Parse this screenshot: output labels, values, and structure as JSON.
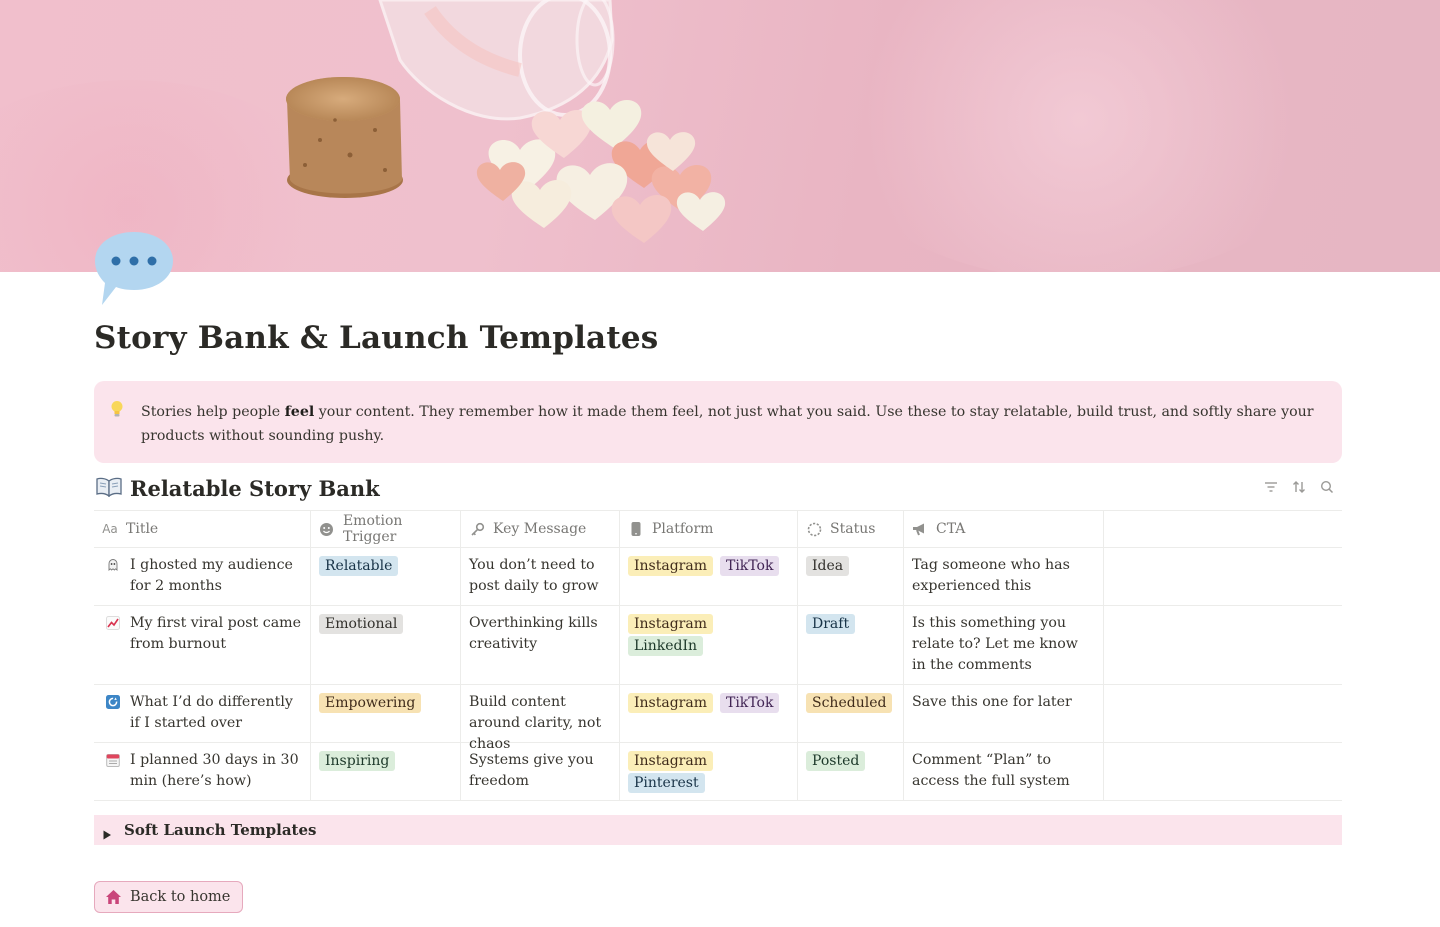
{
  "page": {
    "title": "Story Bank & Launch Templates",
    "icon": "speech-bubble-icon"
  },
  "callout": {
    "icon": "lightbulb-icon",
    "text_before": "Stories help people ",
    "text_bold": "feel",
    "text_after": " your content. They remember how it made them feel, not just what you said. Use these to stay relatable, build trust, and softly share your products without sounding pushy."
  },
  "database": {
    "icon": "open-book-icon",
    "title": "Relatable Story Bank",
    "tools": [
      "filter-icon",
      "sort-icon",
      "search-icon"
    ],
    "columns": [
      {
        "label": "Title",
        "icon": "text-aa-icon"
      },
      {
        "label": "Emotion Trigger",
        "icon": "smiley-icon"
      },
      {
        "label": "Key Message",
        "icon": "key-icon"
      },
      {
        "label": "Platform",
        "icon": "phone-icon"
      },
      {
        "label": "Status",
        "icon": "status-circle-icon"
      },
      {
        "label": "CTA",
        "icon": "megaphone-icon"
      }
    ],
    "rows": [
      {
        "icon": "ghost-icon",
        "title": "I ghosted my audience for 2 months",
        "emotion": {
          "label": "Relatable",
          "color": "blue"
        },
        "key_message": "You don’t need to post daily to grow",
        "platforms": [
          {
            "label": "Instagram",
            "color": "yellow"
          },
          {
            "label": "TikTok",
            "color": "purple"
          }
        ],
        "status": {
          "label": "Idea",
          "color": "gray"
        },
        "cta": "Tag someone who has experienced this"
      },
      {
        "icon": "chart-increasing-icon",
        "title": "My first viral post came from burnout",
        "emotion": {
          "label": "Emotional",
          "color": "gray"
        },
        "key_message": "Overthinking kills creativity",
        "platforms": [
          {
            "label": "Instagram",
            "color": "yellow"
          },
          {
            "label": "LinkedIn",
            "color": "green"
          }
        ],
        "status": {
          "label": "Draft",
          "color": "blue"
        },
        "cta": "Is this something you relate to? Let me know in the comments"
      },
      {
        "icon": "counterclockwise-arrows-icon",
        "title": "What I’d do differently if I started over",
        "emotion": {
          "label": "Empowering",
          "color": "yellow"
        },
        "key_message": "Build content around clarity, not chaos",
        "platforms": [
          {
            "label": "Instagram",
            "color": "yellow"
          },
          {
            "label": "TikTok",
            "color": "purple"
          }
        ],
        "status": {
          "label": "Scheduled",
          "color": "yellow"
        },
        "cta": "Save this one for later"
      },
      {
        "icon": "calendar-icon",
        "title": "I planned 30 days in 30 min (here’s how)",
        "emotion": {
          "label": "Inspiring",
          "color": "green"
        },
        "key_message": "Systems give you freedom",
        "platforms": [
          {
            "label": "Instagram",
            "color": "yellow"
          },
          {
            "label": "Pinterest",
            "color": "blue"
          }
        ],
        "status": {
          "label": "Posted",
          "color": "green"
        },
        "cta": "Comment “Plan” to access the full system"
      }
    ]
  },
  "toggle": {
    "label": "Soft Launch Templates",
    "icon": "triangle-right-icon"
  },
  "back_button": {
    "label": "Back to home",
    "icon": "house-icon"
  },
  "colors": {
    "callout_bg": "#fbe4ec",
    "accent_pink": "#c9457a"
  }
}
